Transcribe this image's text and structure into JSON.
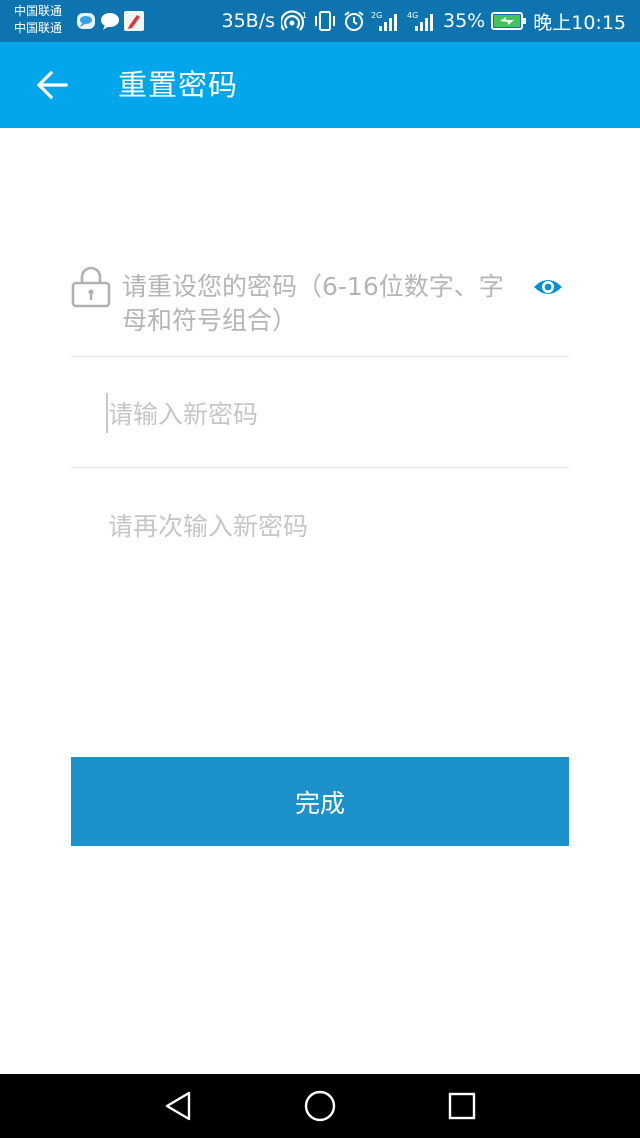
{
  "status_bar": {
    "carrier_1": "中国联通",
    "carrier_2": "中国联通",
    "speed": "35B/s",
    "hotspot_badge": "1",
    "signal_1_label": "2G",
    "signal_2_label": "4G",
    "battery": "35%",
    "time": "晚上10:15"
  },
  "app_bar": {
    "title": "重置密码"
  },
  "form": {
    "hint": "请重设您的密码（6-16位数字、字母和符号组合）",
    "new_password_placeholder": "请输入新密码",
    "new_password_value": "",
    "confirm_password_placeholder": "请再次输入新密码",
    "confirm_password_value": ""
  },
  "done_button_label": "完成",
  "colors": {
    "status_bar": "#0e74b0",
    "app_bar": "#03a6ea",
    "button": "#1d91c9",
    "eye_icon": "#0a8fd0",
    "placeholder": "#c6c6c6"
  },
  "icons": [
    "back-arrow-icon",
    "lock-icon",
    "eye-icon",
    "nav-back-icon",
    "nav-home-icon",
    "nav-recents-icon"
  ]
}
